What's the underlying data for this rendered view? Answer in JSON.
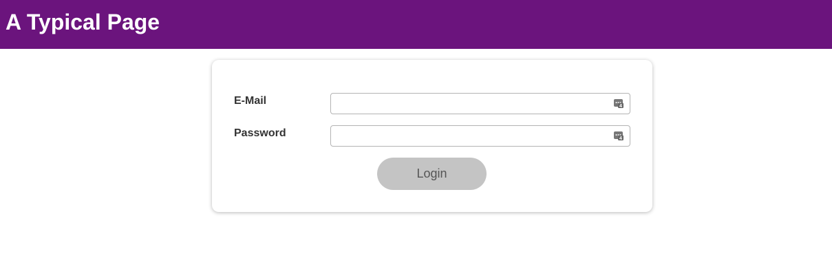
{
  "header": {
    "title": "A Typical Page",
    "background_color": "#6b147d"
  },
  "form": {
    "email": {
      "label": "E-Mail",
      "value": "",
      "placeholder": "",
      "icon": "password-manager-icon"
    },
    "password": {
      "label": "Password",
      "value": "",
      "placeholder": "",
      "icon": "password-manager-icon"
    },
    "login_button": {
      "label": "Login",
      "background_color": "#c4c4c4"
    }
  }
}
